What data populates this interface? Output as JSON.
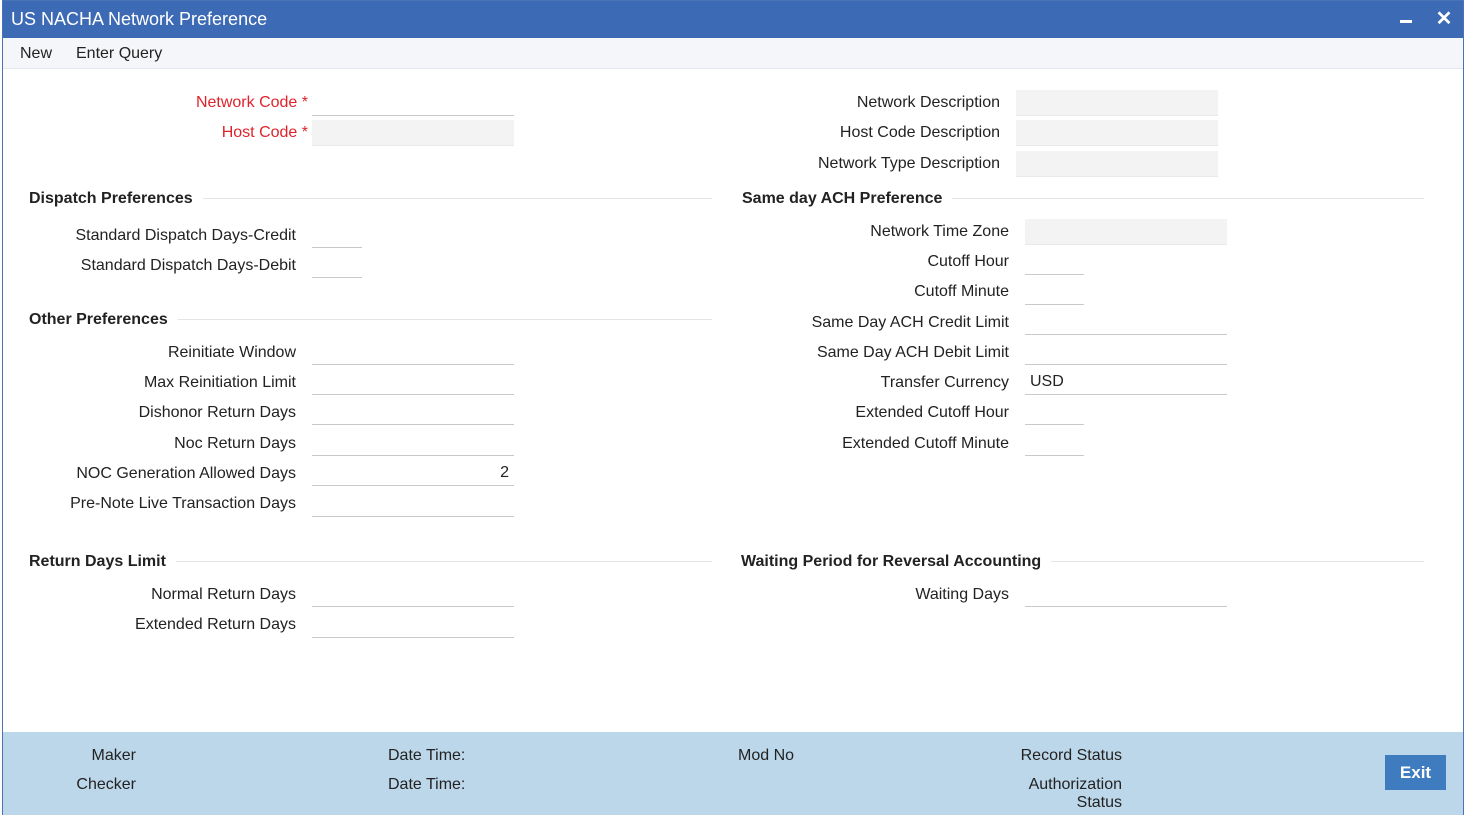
{
  "window": {
    "title": "US NACHA Network Preference",
    "minimize_icon": "minimize-icon",
    "close_glyph": "✕"
  },
  "menu": {
    "new": "New",
    "enter_query": "Enter Query"
  },
  "header": {
    "network_code": {
      "label": "Network Code",
      "required": "*",
      "value": ""
    },
    "host_code": {
      "label": "Host Code",
      "required": "*",
      "value": ""
    },
    "network_description": {
      "label": "Network Description",
      "value": ""
    },
    "host_code_description": {
      "label": "Host Code Description",
      "value": ""
    },
    "network_type_description": {
      "label": "Network Type Description",
      "value": ""
    }
  },
  "dispatch": {
    "title": "Dispatch Preferences",
    "credit": {
      "label": "Standard Dispatch Days-Credit",
      "value": ""
    },
    "debit": {
      "label": "Standard Dispatch Days-Debit",
      "value": ""
    }
  },
  "same_day": {
    "title": "Same day ACH Preference",
    "network_time_zone": {
      "label": "Network Time Zone",
      "value": ""
    },
    "cutoff_hour": {
      "label": "Cutoff Hour",
      "value": ""
    },
    "cutoff_minute": {
      "label": "Cutoff Minute",
      "value": ""
    },
    "credit_limit": {
      "label": "Same Day ACH Credit Limit",
      "value": ""
    },
    "debit_limit": {
      "label": "Same Day ACH Debit Limit",
      "value": ""
    },
    "transfer_currency": {
      "label": "Transfer Currency",
      "value": "USD"
    },
    "ext_cutoff_hour": {
      "label": "Extended Cutoff Hour",
      "value": ""
    },
    "ext_cutoff_minute": {
      "label": "Extended Cutoff Minute",
      "value": ""
    }
  },
  "other": {
    "title": "Other Preferences",
    "reinitiate_window": {
      "label": "Reinitiate Window",
      "value": ""
    },
    "max_reinitiation_limit": {
      "label": "Max Reinitiation Limit",
      "value": ""
    },
    "dishonor_return_days": {
      "label": "Dishonor Return Days",
      "value": ""
    },
    "noc_return_days": {
      "label": "Noc Return Days",
      "value": ""
    },
    "noc_generation_allowed_days": {
      "label": "NOC Generation Allowed Days",
      "value": "2"
    },
    "prenote_live_days": {
      "label": "Pre-Note Live Transaction Days",
      "value": ""
    }
  },
  "return_days": {
    "title": "Return Days Limit",
    "normal": {
      "label": "Normal Return Days",
      "value": ""
    },
    "extended": {
      "label": "Extended Return Days",
      "value": ""
    }
  },
  "waiting": {
    "title": "Waiting Period for Reversal Accounting",
    "waiting_days": {
      "label": "Waiting Days",
      "value": ""
    }
  },
  "footer": {
    "maker": "Maker",
    "checker": "Checker",
    "date_time_1": "Date Time:",
    "date_time_2": "Date Time:",
    "mod_no": "Mod No",
    "record_status": "Record Status",
    "authorization": "Authorization",
    "status": "Status",
    "exit": "Exit"
  }
}
